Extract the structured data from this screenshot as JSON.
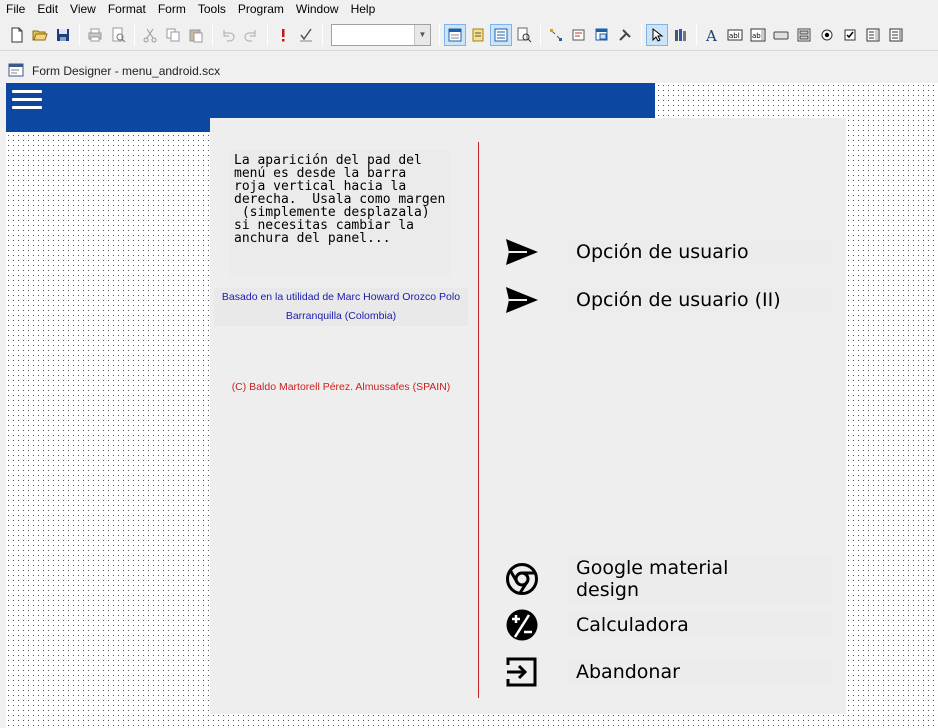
{
  "menubar": {
    "items": [
      "File",
      "Edit",
      "View",
      "Format",
      "Form",
      "Tools",
      "Program",
      "Window",
      "Help"
    ]
  },
  "toolbar": {
    "combo_value": "",
    "icons": [
      "new-icon",
      "open-icon",
      "save-icon",
      "print-icon",
      "print-preview-icon",
      "cut-icon",
      "copy-icon",
      "paste-icon",
      "undo-icon",
      "redo-icon",
      "run-icon",
      "code-check-icon",
      "form-properties-icon",
      "form-control-icon",
      "data-environment-icon",
      "code-window-icon",
      "zoom-icon",
      "class-browser-icon",
      "builder-icon",
      "tools-icon",
      "pointer-icon",
      "view-classes-icon",
      "label-tool-icon",
      "textbox-tool-icon",
      "editbox-tool-icon",
      "button-tool-icon",
      "button-group-tool-icon",
      "option-tool-icon",
      "checkbox-tool-icon",
      "combobox-tool-icon",
      "listbox-tool-icon"
    ]
  },
  "designer": {
    "title": "Form Designer - menu_android.scx"
  },
  "form": {
    "note": "La aparición del pad del\nmenú es desde la barra\nroja vertical hacia la\nderecha.  Usala como margen\n (simplemente desplazala)\nsi necesitas cambiar la\nanchura del panel...",
    "credit_line1": "Basado en la utilidad  de Marc Howard Orozco  Polo",
    "credit_line2": "Barranquilla (Colombia)",
    "copyright": "(C) Baldo Martorell Pérez. Almussafes (SPAIN)",
    "options": [
      {
        "label": "Opción de usuario",
        "icon": "send-arrow-icon"
      },
      {
        "label": "Opción de usuario (II)",
        "icon": "send-arrow-icon"
      },
      {
        "label": "Google material design",
        "icon": "chrome-icon"
      },
      {
        "label": "Calculadora",
        "icon": "calculator-icon"
      },
      {
        "label": "Abandonar",
        "icon": "exit-icon"
      }
    ],
    "colors": {
      "header_blue": "#0c47a1",
      "red_line": "#c22222",
      "credit_blue": "#1a1ab0",
      "copyright_red": "#cc1f1f"
    }
  }
}
